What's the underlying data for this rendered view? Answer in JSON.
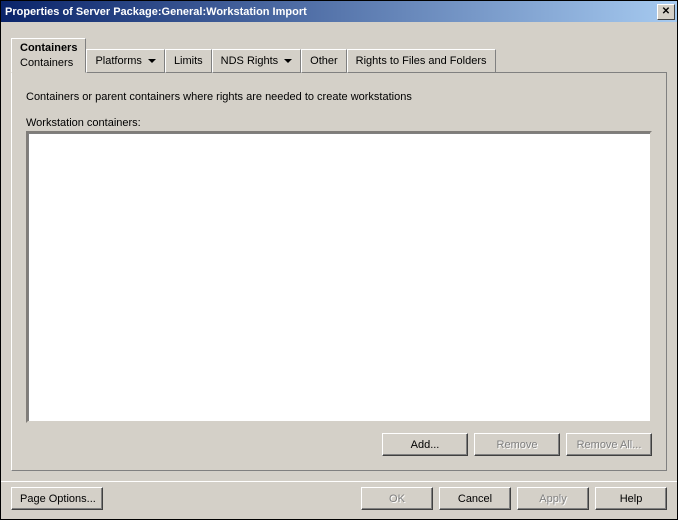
{
  "window": {
    "title": "Properties of Server Package:General:Workstation Import"
  },
  "tabs": {
    "containers": {
      "label": "Containers",
      "sublabel": "Containers"
    },
    "platforms": {
      "label": "Platforms"
    },
    "limits": {
      "label": "Limits"
    },
    "nds_rights": {
      "label": "NDS Rights"
    },
    "other": {
      "label": "Other"
    },
    "rights_ff": {
      "label": "Rights to Files and Folders"
    }
  },
  "panel": {
    "instruction": "Containers or parent containers where rights are needed to create workstations",
    "list_label": "Workstation containers:",
    "items": []
  },
  "list_buttons": {
    "add": "Add...",
    "remove": "Remove",
    "remove_all": "Remove All..."
  },
  "footer": {
    "page_options": "Page Options...",
    "ok": "OK",
    "cancel": "Cancel",
    "apply": "Apply",
    "help": "Help"
  }
}
